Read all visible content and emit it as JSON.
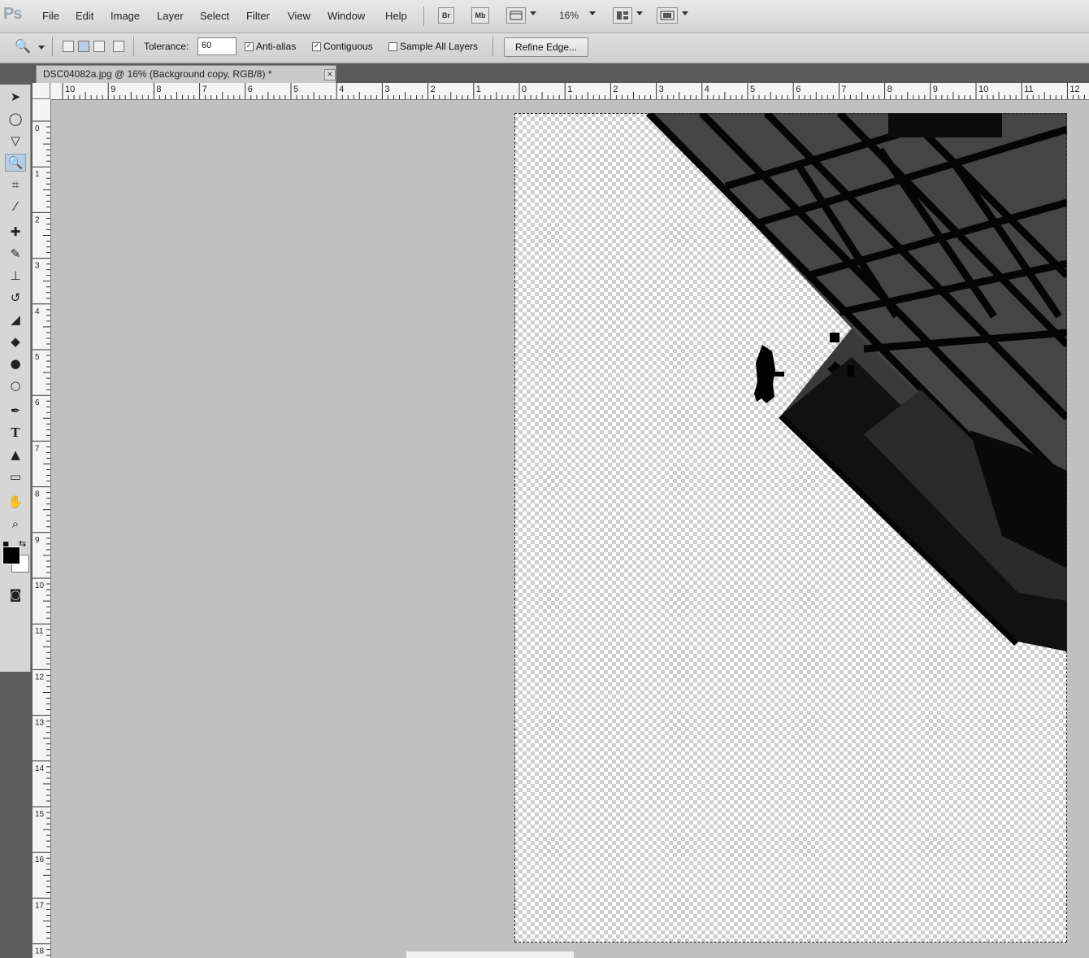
{
  "app": {
    "logo": "Ps"
  },
  "menu": [
    "File",
    "Edit",
    "Image",
    "Layer",
    "Select",
    "Filter",
    "View",
    "Window",
    "Help"
  ],
  "appbar": {
    "bridge_label": "Br",
    "minibridge_label": "Mb",
    "zoom": "16%"
  },
  "options": {
    "tolerance_label": "Tolerance:",
    "tolerance_value": "60",
    "anti_alias": "Anti-alias",
    "contiguous": "Contiguous",
    "sample_all_layers": "Sample All Layers",
    "refine_edge": "Refine Edge..."
  },
  "document": {
    "tab_title": "DSC04082a.jpg @ 16% (Background copy, RGB/8) *",
    "close_glyph": "×"
  },
  "ruler": {
    "horizontal": [
      "10",
      "9",
      "8",
      "7",
      "6",
      "5",
      "4",
      "3",
      "2",
      "1",
      "0",
      "1",
      "2",
      "3",
      "4",
      "5",
      "6",
      "7",
      "8",
      "9",
      "10",
      "11",
      "12"
    ],
    "vertical": [
      "0",
      "1",
      "2",
      "3",
      "4",
      "5",
      "6",
      "7",
      "8",
      "9",
      "10",
      "11",
      "12",
      "13",
      "14",
      "15",
      "16",
      "17",
      "18"
    ]
  },
  "icons": {
    "tools": [
      "move-icon",
      "lasso-icon",
      "polygon-lasso-icon",
      "quick-selection-icon",
      "crop-icon",
      "eyedropper-icon",
      "healing-brush-icon",
      "brush-icon",
      "clone-stamp-icon",
      "history-brush-icon",
      "eraser-icon",
      "paint-bucket-icon",
      "blur-icon",
      "dodge-icon",
      "pen-icon",
      "type-icon",
      "path-selection-icon",
      "rectangle-icon",
      "hand-icon",
      "zoom-icon"
    ]
  },
  "colors": {
    "foreground": "#000000",
    "background": "#ffffff",
    "canvas": "#c0c0c0"
  }
}
